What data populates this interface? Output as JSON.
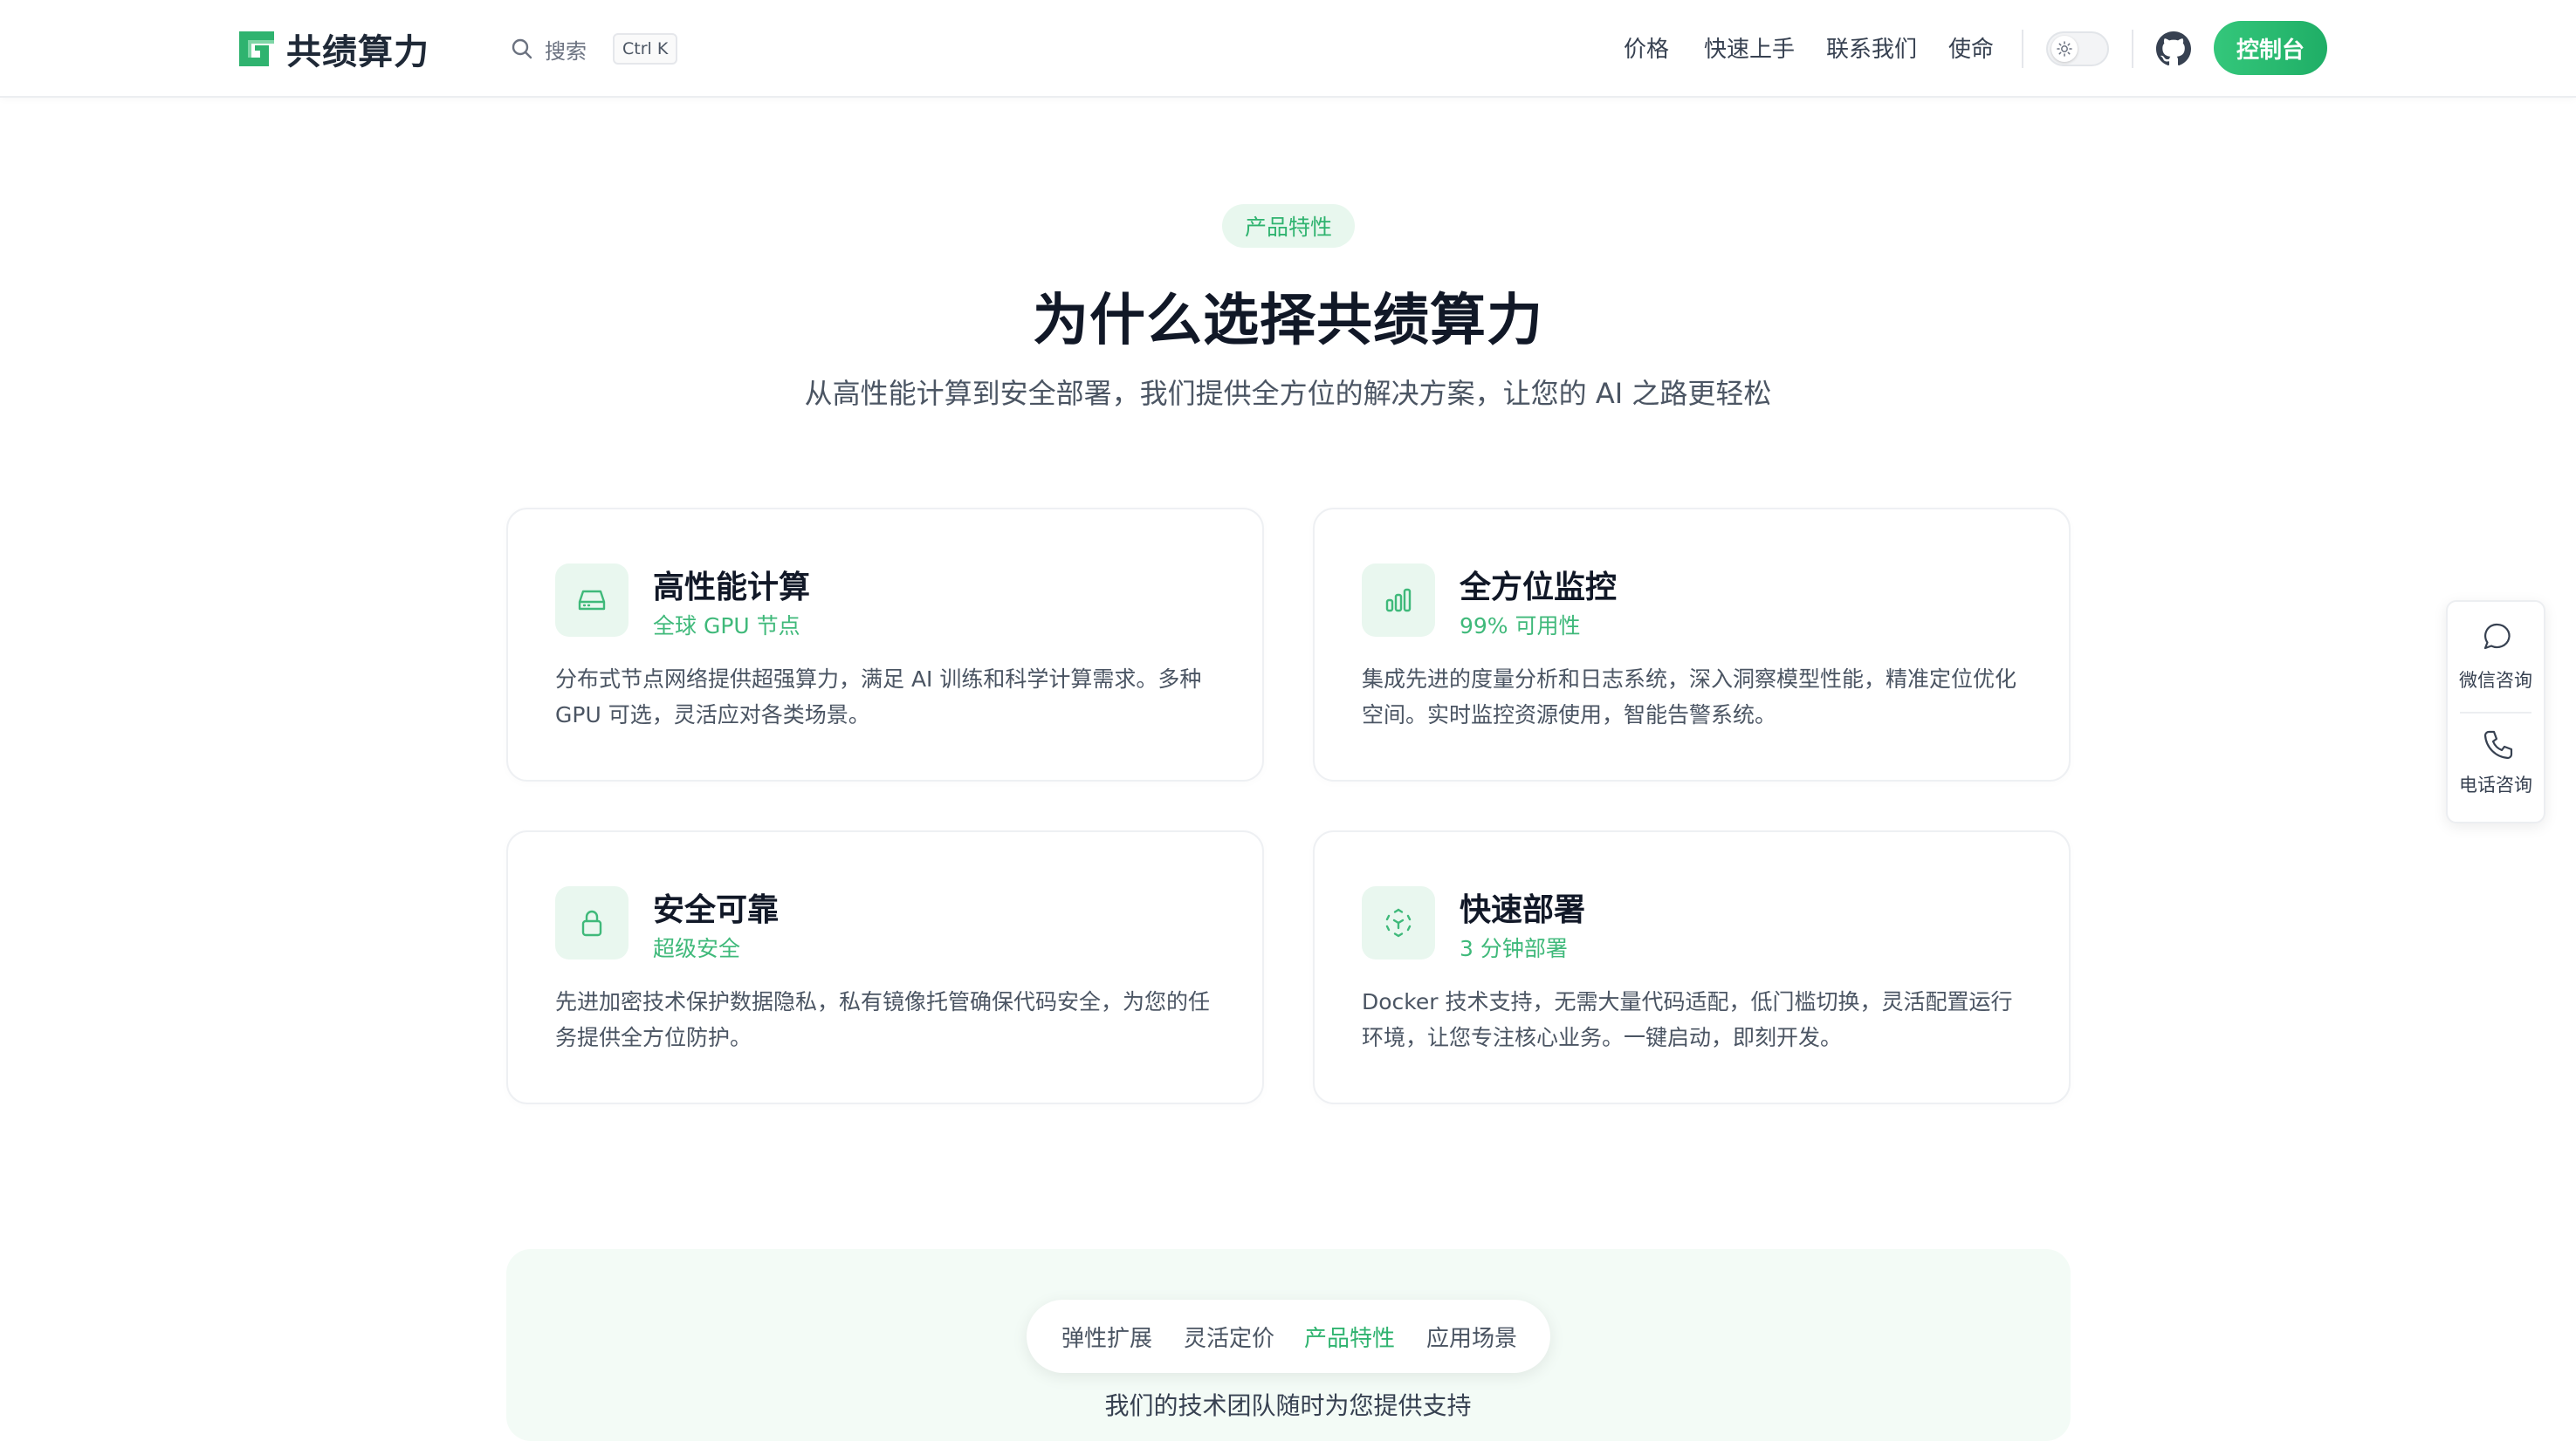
{
  "brand": {
    "name": "共绩算力",
    "accent": "#2fb36f"
  },
  "search": {
    "label": "搜索",
    "shortcut": "Ctrl K"
  },
  "nav": {
    "items": [
      "价格",
      "快速上手",
      "联系我们",
      "使命"
    ]
  },
  "header": {
    "console_label": "控制台",
    "github_icon": "github-icon",
    "theme_icon": "sun-icon"
  },
  "hero": {
    "badge": "产品特性",
    "title": "为什么选择共绩算力",
    "subtitle": "从高性能计算到安全部署，我们提供全方位的解决方案，让您的 AI 之路更轻松"
  },
  "features": [
    {
      "icon": "server-icon",
      "title": "高性能计算",
      "subtitle": "全球 GPU 节点",
      "desc": "分布式节点网络提供超强算力，满足 AI 训练和科学计算需求。多种 GPU 可选，灵活应对各类场景。"
    },
    {
      "icon": "bar-chart-icon",
      "title": "全方位监控",
      "subtitle": "99% 可用性",
      "desc": "集成先进的度量分析和日志系统，深入洞察模型性能，精准定位优化空间。实时监控资源使用，智能告警系统。"
    },
    {
      "icon": "lock-icon",
      "title": "安全可靠",
      "subtitle": "超级安全",
      "desc": "先进加密技术保护数据隐私，私有镜像托管确保代码安全，为您的任务提供全方位防护。"
    },
    {
      "icon": "deploy-icon",
      "title": "快速部署",
      "subtitle": "3 分钟部署",
      "desc": "Docker 技术支持，无需大量代码适配，低门槛切换，灵活配置运行环境，让您专注核心业务。一键启动，即刻开发。"
    }
  ],
  "tabs": {
    "items": [
      "弹性扩展",
      "灵活定价",
      "产品特性",
      "应用场景"
    ],
    "active": "产品特性"
  },
  "support": {
    "text": "我们的技术团队随时为您提供支持"
  },
  "float": {
    "wechat_label": "微信咨询",
    "phone_label": "电话咨询"
  }
}
